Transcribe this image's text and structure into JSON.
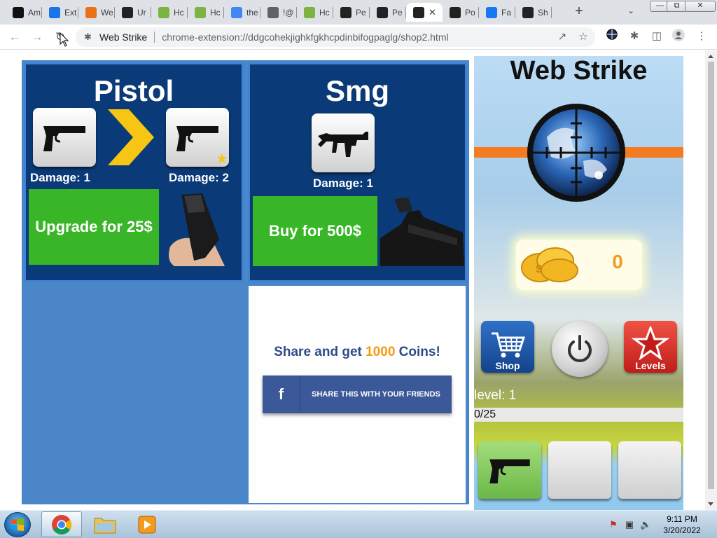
{
  "browser": {
    "tabs": [
      {
        "title": "Am",
        "icon": "amazon-icon",
        "color": "#111111"
      },
      {
        "title": "Ext",
        "icon": "puzzle-icon",
        "color": "#1a73e8"
      },
      {
        "title": "We",
        "icon": "extension-icon",
        "color": "#e8711a"
      },
      {
        "title": "Ur",
        "icon": "crosshair-globe-icon",
        "color": "#222222"
      },
      {
        "title": "Hc",
        "icon": "green-flag-icon",
        "color": "#7cb342"
      },
      {
        "title": "Hc",
        "icon": "green-flag-icon",
        "color": "#7cb342"
      },
      {
        "title": "the",
        "icon": "google-icon",
        "color": "#4285f4"
      },
      {
        "title": "!@",
        "icon": "globe-icon",
        "color": "#5f6368"
      },
      {
        "title": "Hc",
        "icon": "green-flag-icon",
        "color": "#7cb342"
      },
      {
        "title": "Pe",
        "icon": "p-logo-icon",
        "color": "#222222"
      },
      {
        "title": "Pe",
        "icon": "p-logo-icon",
        "color": "#222222"
      },
      {
        "title": "",
        "icon": "crosshair-globe-icon",
        "color": "#222222",
        "active": true
      },
      {
        "title": "Po",
        "icon": "crosshair-globe-icon",
        "color": "#222222"
      },
      {
        "title": "Fa",
        "icon": "facebook-icon",
        "color": "#1877f2"
      },
      {
        "title": "Sh",
        "icon": "crosshair-globe-icon",
        "color": "#222222"
      }
    ],
    "site_name": "Web Strike",
    "url": "chrome-extension://ddgcohekjighkfgkhcpdinbifogpaglg/shop2.html"
  },
  "shop": {
    "pistol": {
      "title": "Pistol",
      "damage_current": "Damage: 1",
      "damage_next": "Damage: 2",
      "button": "Upgrade for 25$"
    },
    "smg": {
      "title": "Smg",
      "damage": "Damage: 1",
      "button": "Buy for 500$"
    },
    "share": {
      "text_before": "Share and get ",
      "amount": "1000",
      "text_after": " Coins!",
      "fb_letter": "f",
      "button": "SHARE THIS WITH YOUR FRIENDS"
    }
  },
  "game": {
    "title": "Web Strike",
    "coins": "0",
    "shop_label": "Shop",
    "levels_label": "Levels",
    "level": "level: 1",
    "progress": "0/25"
  },
  "taskbar": {
    "time": "9:11 PM",
    "date": "3/20/2022"
  },
  "colors": {
    "shop_bg": "#4a86c8",
    "card_bg": "#0a3a78",
    "green": "#38b628",
    "orange": "#f47b20",
    "facebook": "#3b5998"
  }
}
